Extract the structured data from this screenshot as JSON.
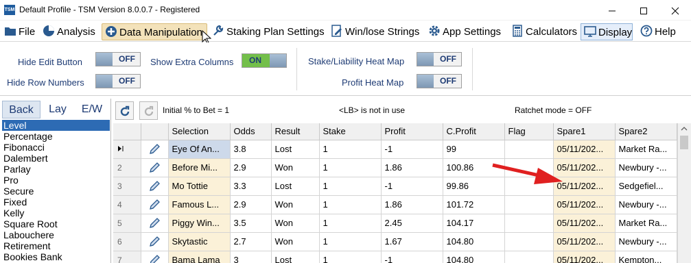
{
  "window": {
    "title": "Default Profile  -  TSM Version 8.0.0.7 - Registered",
    "logo_text": "TSM"
  },
  "menu": {
    "items": [
      {
        "label": "File",
        "icon": "folder-icon"
      },
      {
        "label": "Analysis",
        "icon": "pie-chart-icon"
      },
      {
        "label": "Data Manipulation",
        "icon": "plus-circle-icon",
        "active": true
      },
      {
        "label": "Staking Plan Settings",
        "icon": "wrench-icon"
      },
      {
        "label": "Win/lose Strings",
        "icon": "edit-document-icon"
      },
      {
        "label": "App Settings",
        "icon": "gear-icon"
      },
      {
        "label": "Calculators",
        "icon": "calculator-icon"
      },
      {
        "label": "Display",
        "icon": "monitor-icon"
      },
      {
        "label": "Help",
        "icon": "help-icon"
      }
    ]
  },
  "options": {
    "hide_edit_button": {
      "label": "Hide Edit Button",
      "value": "OFF"
    },
    "hide_row_numbers": {
      "label": "Hide Row Numbers",
      "value": "OFF"
    },
    "show_extra_columns": {
      "label": "Show Extra Columns",
      "value": "ON"
    },
    "stake_liability_heat_map": {
      "label": "Stake/Liability Heat Map",
      "value": "OFF"
    },
    "profit_heat_map": {
      "label": "Profit Heat Map",
      "value": "OFF"
    }
  },
  "left_panel": {
    "tabs": [
      "Back",
      "Lay",
      "E/W"
    ],
    "active_tab": "Back",
    "methods": [
      "Level",
      "Percentage",
      "Fibonacci",
      "Dalembert",
      "Parlay",
      "Pro",
      "Secure",
      "Fixed",
      "Kelly",
      "Square Root",
      "Labouchere",
      "Retirement",
      "Bookies Bank"
    ],
    "selected": "Level"
  },
  "toolbar": {
    "initial_pct": "Initial % to Bet = 1",
    "lb_status": "<LB> is not in use",
    "ratchet": "Ratchet mode = OFF"
  },
  "grid": {
    "columns": [
      "Selection",
      "Odds",
      "Result",
      "Stake",
      "Profit",
      "C.Profit",
      "Flag",
      "Spare1",
      "Spare2"
    ],
    "rows": [
      {
        "num": "",
        "selection": "Eye Of An...",
        "odds": "3.8",
        "result": "Lost",
        "stake": "1",
        "profit": "-1",
        "cprofit": "99",
        "flag": "",
        "spare1": "05/11/202...",
        "spare2": "Market Ra..."
      },
      {
        "num": "2",
        "selection": "Before Mi...",
        "odds": "2.9",
        "result": "Won",
        "stake": "1",
        "profit": "1.86",
        "cprofit": "100.86",
        "flag": "",
        "spare1": "05/11/202...",
        "spare2": "Newbury -..."
      },
      {
        "num": "3",
        "selection": "Mo Tottie",
        "odds": "3.3",
        "result": "Lost",
        "stake": "1",
        "profit": "-1",
        "cprofit": "99.86",
        "flag": "",
        "spare1": "05/11/202...",
        "spare2": "Sedgefiel..."
      },
      {
        "num": "4",
        "selection": "Famous L...",
        "odds": "2.9",
        "result": "Won",
        "stake": "1",
        "profit": "1.86",
        "cprofit": "101.72",
        "flag": "",
        "spare1": "05/11/202...",
        "spare2": "Newbury -..."
      },
      {
        "num": "5",
        "selection": "Piggy Win...",
        "odds": "3.5",
        "result": "Won",
        "stake": "1",
        "profit": "2.45",
        "cprofit": "104.17",
        "flag": "",
        "spare1": "05/11/202...",
        "spare2": "Market Ra..."
      },
      {
        "num": "6",
        "selection": "Skytastic",
        "odds": "2.7",
        "result": "Won",
        "stake": "1",
        "profit": "1.67",
        "cprofit": "104.80",
        "flag": "",
        "spare1": "05/11/202...",
        "spare2": "Newbury -..."
      },
      {
        "num": "7",
        "selection": "Bama Lama",
        "odds": "3",
        "result": "Lost",
        "stake": "1",
        "profit": "-1",
        "cprofit": "104.80",
        "flag": "",
        "spare1": "05/11/202...",
        "spare2": "Kempton..."
      }
    ]
  },
  "colors": {
    "accent": "#2d6bb4",
    "arrow": "#e02020",
    "highlight_col": "#fbf1d8",
    "toggle_on": "#73bf4a"
  }
}
